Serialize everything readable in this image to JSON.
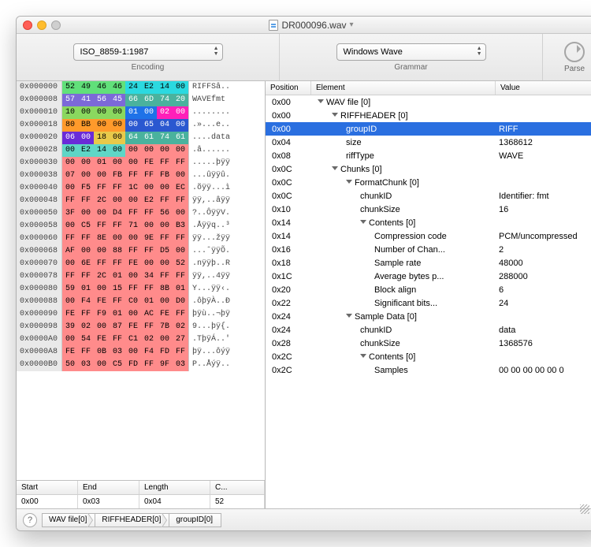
{
  "title": "DR000096.wav",
  "toolbar": {
    "encoding_value": "ISO_8859-1:1987",
    "encoding_label": "Encoding",
    "grammar_value": "Windows Wave",
    "grammar_label": "Grammar",
    "parse_label": "Parse"
  },
  "hex_rows": [
    {
      "addr": "0x000000",
      "b": [
        {
          "t": "52",
          "c": "c-green"
        },
        {
          "t": "49",
          "c": "c-green"
        },
        {
          "t": "46",
          "c": "c-green"
        },
        {
          "t": "46",
          "c": "c-green"
        },
        {
          "t": "24",
          "c": "c-cyan"
        },
        {
          "t": "E2",
          "c": "c-cyan"
        },
        {
          "t": "14",
          "c": "c-cyan"
        },
        {
          "t": "00",
          "c": "c-cyan"
        }
      ],
      "a": "RIFFSâ.."
    },
    {
      "addr": "0x000008",
      "b": [
        {
          "t": "57",
          "c": "c-purple"
        },
        {
          "t": "41",
          "c": "c-purple"
        },
        {
          "t": "56",
          "c": "c-purple"
        },
        {
          "t": "45",
          "c": "c-purple"
        },
        {
          "t": "66",
          "c": "c-teal"
        },
        {
          "t": "6D",
          "c": "c-teal"
        },
        {
          "t": "74",
          "c": "c-teal"
        },
        {
          "t": "20",
          "c": "c-teal"
        }
      ],
      "a": "WAVEfmt "
    },
    {
      "addr": "0x000010",
      "b": [
        {
          "t": "10",
          "c": "c-lime"
        },
        {
          "t": "00",
          "c": "c-lime"
        },
        {
          "t": "00",
          "c": "c-lime"
        },
        {
          "t": "00",
          "c": "c-lime"
        },
        {
          "t": "01",
          "c": "c-blue"
        },
        {
          "t": "00",
          "c": "c-blue"
        },
        {
          "t": "02",
          "c": "c-pink"
        },
        {
          "t": "00",
          "c": "c-pink"
        }
      ],
      "a": "........"
    },
    {
      "addr": "0x000018",
      "b": [
        {
          "t": "80",
          "c": "c-orange"
        },
        {
          "t": "BB",
          "c": "c-orange"
        },
        {
          "t": "00",
          "c": "c-orange"
        },
        {
          "t": "00",
          "c": "c-orange"
        },
        {
          "t": "00",
          "c": "c-dblue"
        },
        {
          "t": "65",
          "c": "c-dblue"
        },
        {
          "t": "04",
          "c": "c-dblue"
        },
        {
          "t": "00",
          "c": "c-dblue"
        }
      ],
      "a": ".»...e.."
    },
    {
      "addr": "0x000020",
      "b": [
        {
          "t": "06",
          "c": "c-dpurple"
        },
        {
          "t": "00",
          "c": "c-dpurple"
        },
        {
          "t": "18",
          "c": "c-yellow"
        },
        {
          "t": "00",
          "c": "c-yellow"
        },
        {
          "t": "64",
          "c": "c-teal"
        },
        {
          "t": "61",
          "c": "c-teal"
        },
        {
          "t": "74",
          "c": "c-teal"
        },
        {
          "t": "61",
          "c": "c-teal"
        }
      ],
      "a": "....data"
    },
    {
      "addr": "0x000028",
      "b": [
        {
          "t": "00",
          "c": "c-lteal"
        },
        {
          "t": "E2",
          "c": "c-lteal"
        },
        {
          "t": "14",
          "c": "c-lteal"
        },
        {
          "t": "00",
          "c": "c-lteal"
        },
        {
          "t": "00",
          "c": "c-red"
        },
        {
          "t": "00",
          "c": "c-red"
        },
        {
          "t": "00",
          "c": "c-red"
        },
        {
          "t": "00",
          "c": "c-red"
        }
      ],
      "a": ".â......"
    },
    {
      "addr": "0x000030",
      "b": [
        {
          "t": "00",
          "c": "c-red"
        },
        {
          "t": "00",
          "c": "c-red"
        },
        {
          "t": "01",
          "c": "c-red"
        },
        {
          "t": "00",
          "c": "c-red"
        },
        {
          "t": "00",
          "c": "c-red"
        },
        {
          "t": "FE",
          "c": "c-red"
        },
        {
          "t": "FF",
          "c": "c-red"
        },
        {
          "t": "FF",
          "c": "c-red"
        }
      ],
      "a": ".....þÿÿ"
    },
    {
      "addr": "0x000038",
      "b": [
        {
          "t": "07",
          "c": "c-red"
        },
        {
          "t": "00",
          "c": "c-red"
        },
        {
          "t": "00",
          "c": "c-red"
        },
        {
          "t": "FB",
          "c": "c-red"
        },
        {
          "t": "FF",
          "c": "c-red"
        },
        {
          "t": "FF",
          "c": "c-red"
        },
        {
          "t": "FB",
          "c": "c-red"
        },
        {
          "t": "00",
          "c": "c-red"
        }
      ],
      "a": "...ûÿÿû."
    },
    {
      "addr": "0x000040",
      "b": [
        {
          "t": "00",
          "c": "c-red"
        },
        {
          "t": "F5",
          "c": "c-red"
        },
        {
          "t": "FF",
          "c": "c-red"
        },
        {
          "t": "FF",
          "c": "c-red"
        },
        {
          "t": "1C",
          "c": "c-red"
        },
        {
          "t": "00",
          "c": "c-red"
        },
        {
          "t": "00",
          "c": "c-red"
        },
        {
          "t": "EC",
          "c": "c-red"
        }
      ],
      "a": ".õÿÿ...ì"
    },
    {
      "addr": "0x000048",
      "b": [
        {
          "t": "FF",
          "c": "c-red"
        },
        {
          "t": "FF",
          "c": "c-red"
        },
        {
          "t": "2C",
          "c": "c-red"
        },
        {
          "t": "00",
          "c": "c-red"
        },
        {
          "t": "00",
          "c": "c-red"
        },
        {
          "t": "E2",
          "c": "c-red"
        },
        {
          "t": "FF",
          "c": "c-red"
        },
        {
          "t": "FF",
          "c": "c-red"
        }
      ],
      "a": "ÿÿ,..âÿÿ"
    },
    {
      "addr": "0x000050",
      "b": [
        {
          "t": "3F",
          "c": "c-red"
        },
        {
          "t": "00",
          "c": "c-red"
        },
        {
          "t": "00",
          "c": "c-red"
        },
        {
          "t": "D4",
          "c": "c-red"
        },
        {
          "t": "FF",
          "c": "c-red"
        },
        {
          "t": "FF",
          "c": "c-red"
        },
        {
          "t": "56",
          "c": "c-red"
        },
        {
          "t": "00",
          "c": "c-red"
        }
      ],
      "a": "?..ÔÿÿV."
    },
    {
      "addr": "0x000058",
      "b": [
        {
          "t": "00",
          "c": "c-red"
        },
        {
          "t": "C5",
          "c": "c-red"
        },
        {
          "t": "FF",
          "c": "c-red"
        },
        {
          "t": "FF",
          "c": "c-red"
        },
        {
          "t": "71",
          "c": "c-red"
        },
        {
          "t": "00",
          "c": "c-red"
        },
        {
          "t": "00",
          "c": "c-red"
        },
        {
          "t": "B3",
          "c": "c-red"
        }
      ],
      "a": ".Åÿÿq..³"
    },
    {
      "addr": "0x000060",
      "b": [
        {
          "t": "FF",
          "c": "c-red"
        },
        {
          "t": "FF",
          "c": "c-red"
        },
        {
          "t": "8E",
          "c": "c-red"
        },
        {
          "t": "00",
          "c": "c-red"
        },
        {
          "t": "00",
          "c": "c-red"
        },
        {
          "t": "9E",
          "c": "c-red"
        },
        {
          "t": "FF",
          "c": "c-red"
        },
        {
          "t": "FF",
          "c": "c-red"
        }
      ],
      "a": "ÿÿ...žÿÿ"
    },
    {
      "addr": "0x000068",
      "b": [
        {
          "t": "AF",
          "c": "c-red"
        },
        {
          "t": "00",
          "c": "c-red"
        },
        {
          "t": "00",
          "c": "c-red"
        },
        {
          "t": "88",
          "c": "c-red"
        },
        {
          "t": "FF",
          "c": "c-red"
        },
        {
          "t": "FF",
          "c": "c-red"
        },
        {
          "t": "D5",
          "c": "c-red"
        },
        {
          "t": "00",
          "c": "c-red"
        }
      ],
      "a": "...ˆÿÿÕ."
    },
    {
      "addr": "0x000070",
      "b": [
        {
          "t": "00",
          "c": "c-red"
        },
        {
          "t": "6E",
          "c": "c-red"
        },
        {
          "t": "FF",
          "c": "c-red"
        },
        {
          "t": "FF",
          "c": "c-red"
        },
        {
          "t": "FE",
          "c": "c-red"
        },
        {
          "t": "00",
          "c": "c-red"
        },
        {
          "t": "00",
          "c": "c-red"
        },
        {
          "t": "52",
          "c": "c-red"
        }
      ],
      "a": ".nÿÿþ..R"
    },
    {
      "addr": "0x000078",
      "b": [
        {
          "t": "FF",
          "c": "c-red"
        },
        {
          "t": "FF",
          "c": "c-red"
        },
        {
          "t": "2C",
          "c": "c-red"
        },
        {
          "t": "01",
          "c": "c-red"
        },
        {
          "t": "00",
          "c": "c-red"
        },
        {
          "t": "34",
          "c": "c-red"
        },
        {
          "t": "FF",
          "c": "c-red"
        },
        {
          "t": "FF",
          "c": "c-red"
        }
      ],
      "a": "ÿÿ,..4ÿÿ"
    },
    {
      "addr": "0x000080",
      "b": [
        {
          "t": "59",
          "c": "c-red"
        },
        {
          "t": "01",
          "c": "c-red"
        },
        {
          "t": "00",
          "c": "c-red"
        },
        {
          "t": "15",
          "c": "c-red"
        },
        {
          "t": "FF",
          "c": "c-red"
        },
        {
          "t": "FF",
          "c": "c-red"
        },
        {
          "t": "8B",
          "c": "c-red"
        },
        {
          "t": "01",
          "c": "c-red"
        }
      ],
      "a": "Y...ÿÿ‹."
    },
    {
      "addr": "0x000088",
      "b": [
        {
          "t": "00",
          "c": "c-red"
        },
        {
          "t": "F4",
          "c": "c-red"
        },
        {
          "t": "FE",
          "c": "c-red"
        },
        {
          "t": "FF",
          "c": "c-red"
        },
        {
          "t": "C0",
          "c": "c-red"
        },
        {
          "t": "01",
          "c": "c-red"
        },
        {
          "t": "00",
          "c": "c-red"
        },
        {
          "t": "D0",
          "c": "c-red"
        }
      ],
      "a": ".ôþÿÀ..Ð"
    },
    {
      "addr": "0x000090",
      "b": [
        {
          "t": "FE",
          "c": "c-red"
        },
        {
          "t": "FF",
          "c": "c-red"
        },
        {
          "t": "F9",
          "c": "c-red"
        },
        {
          "t": "01",
          "c": "c-red"
        },
        {
          "t": "00",
          "c": "c-red"
        },
        {
          "t": "AC",
          "c": "c-red"
        },
        {
          "t": "FE",
          "c": "c-red"
        },
        {
          "t": "FF",
          "c": "c-red"
        }
      ],
      "a": "þÿù..¬þÿ"
    },
    {
      "addr": "0x000098",
      "b": [
        {
          "t": "39",
          "c": "c-red"
        },
        {
          "t": "02",
          "c": "c-red"
        },
        {
          "t": "00",
          "c": "c-red"
        },
        {
          "t": "87",
          "c": "c-red"
        },
        {
          "t": "FE",
          "c": "c-red"
        },
        {
          "t": "FF",
          "c": "c-red"
        },
        {
          "t": "7B",
          "c": "c-red"
        },
        {
          "t": "02",
          "c": "c-red"
        }
      ],
      "a": "9...þÿ{."
    },
    {
      "addr": "0x0000A0",
      "b": [
        {
          "t": "00",
          "c": "c-red"
        },
        {
          "t": "54",
          "c": "c-red"
        },
        {
          "t": "FE",
          "c": "c-red"
        },
        {
          "t": "FF",
          "c": "c-red"
        },
        {
          "t": "C1",
          "c": "c-red"
        },
        {
          "t": "02",
          "c": "c-red"
        },
        {
          "t": "00",
          "c": "c-red"
        },
        {
          "t": "27",
          "c": "c-red"
        }
      ],
      "a": ".TþÿÁ..'"
    },
    {
      "addr": "0x0000A8",
      "b": [
        {
          "t": "FE",
          "c": "c-red"
        },
        {
          "t": "FF",
          "c": "c-red"
        },
        {
          "t": "0B",
          "c": "c-red"
        },
        {
          "t": "03",
          "c": "c-red"
        },
        {
          "t": "00",
          "c": "c-red"
        },
        {
          "t": "F4",
          "c": "c-red"
        },
        {
          "t": "FD",
          "c": "c-red"
        },
        {
          "t": "FF",
          "c": "c-red"
        }
      ],
      "a": "þÿ...ôýÿ"
    },
    {
      "addr": "0x0000B0",
      "b": [
        {
          "t": "50",
          "c": "c-red"
        },
        {
          "t": "03",
          "c": "c-red"
        },
        {
          "t": "00",
          "c": "c-red"
        },
        {
          "t": "C5",
          "c": "c-red"
        },
        {
          "t": "FD",
          "c": "c-red"
        },
        {
          "t": "FF",
          "c": "c-red"
        },
        {
          "t": "9F",
          "c": "c-red"
        },
        {
          "t": "03",
          "c": "c-red"
        }
      ],
      "a": "P..Åýÿ.."
    }
  ],
  "selection": {
    "headers": {
      "start": "Start",
      "end": "End",
      "length": "Length",
      "count": "C..."
    },
    "row": {
      "start": "0x00",
      "end": "0x03",
      "length": "0x04",
      "count": "52"
    }
  },
  "tree_headers": {
    "pos": "Position",
    "elem": "Element",
    "val": "Value"
  },
  "tree": [
    {
      "pos": "0x00",
      "indent": 0,
      "arrow": true,
      "label": "WAV file [0]",
      "val": ""
    },
    {
      "pos": "0x00",
      "indent": 1,
      "arrow": true,
      "label": "RIFFHEADER [0]",
      "val": ""
    },
    {
      "pos": "0x00",
      "indent": 2,
      "arrow": false,
      "label": "groupID",
      "val": "RIFF",
      "sel": true
    },
    {
      "pos": "0x04",
      "indent": 2,
      "arrow": false,
      "label": "size",
      "val": "1368612"
    },
    {
      "pos": "0x08",
      "indent": 2,
      "arrow": false,
      "label": "riffType",
      "val": "WAVE"
    },
    {
      "pos": "0x0C",
      "indent": 1,
      "arrow": true,
      "label": "Chunks [0]",
      "val": ""
    },
    {
      "pos": "0x0C",
      "indent": 2,
      "arrow": true,
      "label": "FormatChunk [0]",
      "val": ""
    },
    {
      "pos": "0x0C",
      "indent": 3,
      "arrow": false,
      "label": "chunkID",
      "val": "Identifier: fmt"
    },
    {
      "pos": "0x10",
      "indent": 3,
      "arrow": false,
      "label": "chunkSize",
      "val": "16"
    },
    {
      "pos": "0x14",
      "indent": 3,
      "arrow": true,
      "label": "Contents [0]",
      "val": ""
    },
    {
      "pos": "0x14",
      "indent": 4,
      "arrow": false,
      "label": "Compression code",
      "val": "PCM/uncompressed"
    },
    {
      "pos": "0x16",
      "indent": 4,
      "arrow": false,
      "label": "Number of Chan...",
      "val": "2"
    },
    {
      "pos": "0x18",
      "indent": 4,
      "arrow": false,
      "label": "Sample rate",
      "val": "48000"
    },
    {
      "pos": "0x1C",
      "indent": 4,
      "arrow": false,
      "label": "Average bytes p...",
      "val": "288000"
    },
    {
      "pos": "0x20",
      "indent": 4,
      "arrow": false,
      "label": "Block align",
      "val": "6"
    },
    {
      "pos": "0x22",
      "indent": 4,
      "arrow": false,
      "label": "Significant bits...",
      "val": "24"
    },
    {
      "pos": "0x24",
      "indent": 2,
      "arrow": true,
      "label": "Sample Data [0]",
      "val": ""
    },
    {
      "pos": "0x24",
      "indent": 3,
      "arrow": false,
      "label": "chunkID",
      "val": "data"
    },
    {
      "pos": "0x28",
      "indent": 3,
      "arrow": false,
      "label": "chunkSize",
      "val": "1368576"
    },
    {
      "pos": "0x2C",
      "indent": 3,
      "arrow": true,
      "label": "Contents [0]",
      "val": ""
    },
    {
      "pos": "0x2C",
      "indent": 4,
      "arrow": false,
      "label": "Samples",
      "val": "00 00 00 00 00 0"
    }
  ],
  "breadcrumb": [
    "WAV file[0]",
    "RIFFHEADER[0]",
    "groupID[0]"
  ]
}
